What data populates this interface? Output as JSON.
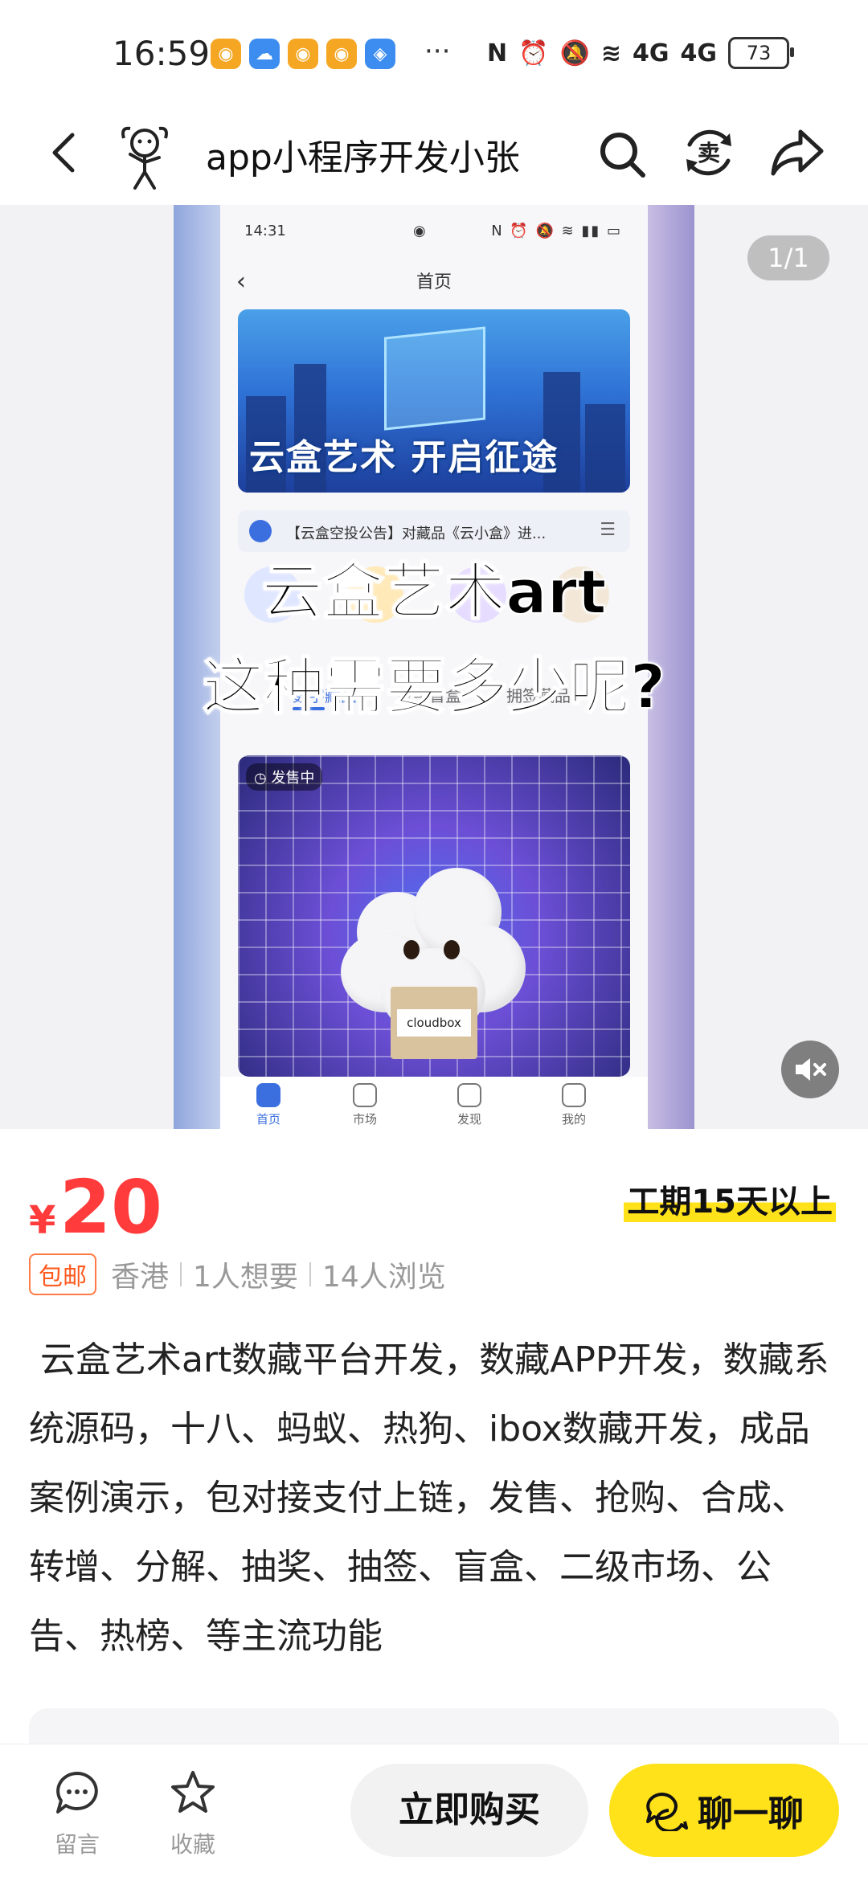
{
  "status_bar": {
    "time": "16:59",
    "more": "···",
    "network_1": "4G",
    "network_2": "4G",
    "battery": "73"
  },
  "nav": {
    "title": "app小程序开发小张",
    "icons": [
      "back-icon",
      "avatar-icon",
      "search-icon",
      "sell-icon",
      "share-icon"
    ]
  },
  "media": {
    "page_indicator": "1/1",
    "overlay_line1": "云盒艺术art",
    "overlay_line2": "这种需要多少呢?",
    "screenshot": {
      "time": "14:31",
      "page_title": "首页",
      "banner_text": "云盒艺术 开启征途",
      "notice": "【云盒空投公告】对藏品《云小盒》进...",
      "tabs": [
        "数字藏品",
        "数字盲盒",
        "拥签藏品"
      ],
      "card_tag": "发售中",
      "box_label": "cloudbox",
      "bottom_nav": [
        "首页",
        "市场",
        "发现",
        "我的"
      ]
    }
  },
  "price": {
    "currency": "¥",
    "value": "20",
    "duration": "工期15天以上"
  },
  "meta": {
    "badge": "包邮",
    "location": "香港",
    "wants": "1人想要",
    "views": "14人浏览"
  },
  "description": " 云盒艺术art数藏平台开发，数藏APP开发，数藏系统源码，十八、蚂蚁、热狗、ibox数藏开发，成品案例演示，包对接支付上链，发售、抢购、合成、转增、分解、抽奖、抽签、盲盒、二级市场、公告、热榜、等主流功能",
  "bottom_bar": {
    "comment": "留言",
    "favorite": "收藏",
    "buy": "立即购买",
    "chat": "聊一聊"
  },
  "colors": {
    "price_red": "#ff3b3b",
    "accent_yellow": "#ffe21a",
    "badge_orange": "#ff5a1f"
  }
}
